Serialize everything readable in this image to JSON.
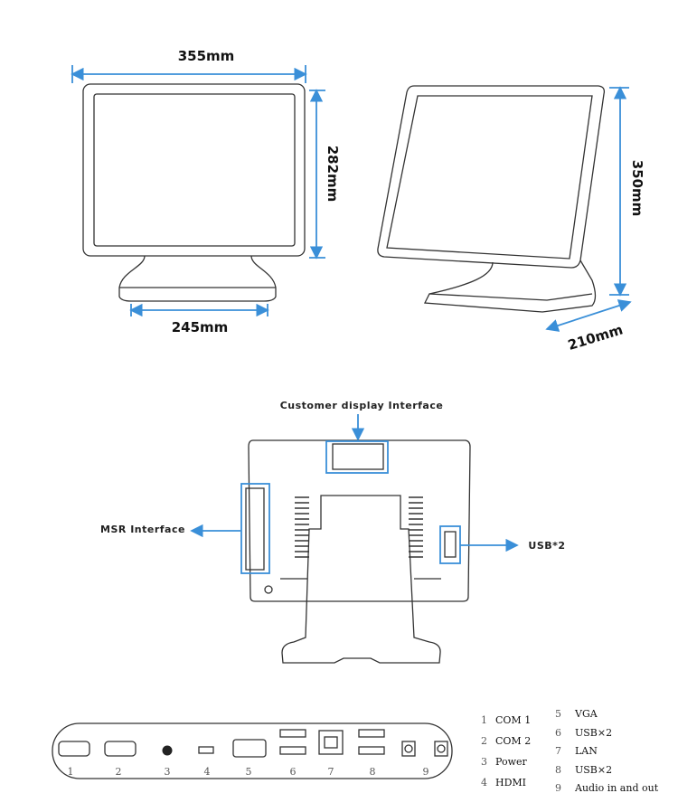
{
  "dimensions": {
    "front_width": "355mm",
    "front_height": "282mm",
    "base_width": "245mm",
    "side_height": "350mm",
    "side_depth": "210mm"
  },
  "back_view": {
    "customer_display": "Customer display Interface",
    "msr": "MSR Interface",
    "usb": "USB*2"
  },
  "port_panel": {
    "numbers": [
      "1",
      "2",
      "3",
      "4",
      "5",
      "6",
      "7",
      "8",
      "9"
    ]
  },
  "legend": [
    {
      "num": "1",
      "label": "COM 1"
    },
    {
      "num": "2",
      "label": "COM 2"
    },
    {
      "num": "3",
      "label": "Power"
    },
    {
      "num": "4",
      "label": "HDMI"
    },
    {
      "num": "5",
      "label": "VGA"
    },
    {
      "num": "6",
      "label": "USB×2"
    },
    {
      "num": "7",
      "label": "LAN"
    },
    {
      "num": "8",
      "label": "USB×2"
    },
    {
      "num": "9",
      "label": "Audio in and out"
    }
  ],
  "colors": {
    "accent": "#3a8fd8",
    "line": "#333333"
  }
}
